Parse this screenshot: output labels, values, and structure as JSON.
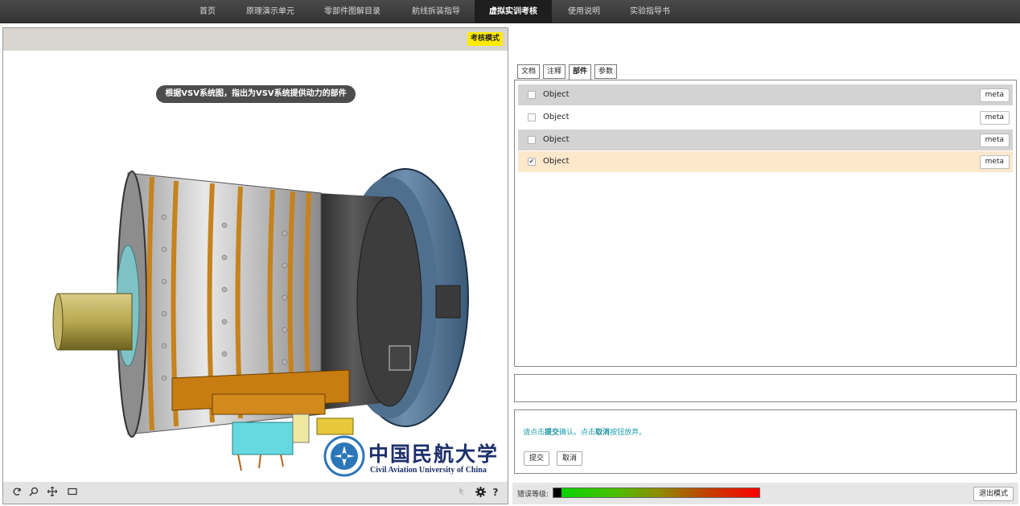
{
  "nav": {
    "items": [
      {
        "label": "首页"
      },
      {
        "label": "原理演示单元"
      },
      {
        "label": "零部件图解目录"
      },
      {
        "label": "航线拆装指导"
      },
      {
        "label": "虚拟实训考核"
      },
      {
        "label": "使用说明"
      },
      {
        "label": "实验指导书"
      }
    ],
    "active": "虚拟实训考核"
  },
  "viewer": {
    "mode_badge": "考核模式",
    "question": "根据VSV系统图，指出为VSV系统提供动力的部件",
    "logo": {
      "cn": "中国民航大学",
      "en": "Civil Aviation University of China"
    },
    "help_label": "?",
    "toolbar_icons": [
      "rotate-icon",
      "zoom-icon",
      "pan-icon",
      "fit-view-icon",
      "cursor-icon",
      "gear-icon",
      "help-icon"
    ]
  },
  "tabs": [
    {
      "label": "文档"
    },
    {
      "label": "注释"
    },
    {
      "label": "部件"
    },
    {
      "label": "参数"
    }
  ],
  "active_tab": "部件",
  "parts": [
    {
      "label": "Object",
      "checked": false,
      "meta": "meta"
    },
    {
      "label": "Object",
      "checked": false,
      "meta": "meta"
    },
    {
      "label": "Object",
      "checked": false,
      "meta": "meta"
    },
    {
      "label": "Object",
      "checked": true,
      "meta": "meta"
    }
  ],
  "confirm": {
    "msg_pre": "请点击",
    "msg_submit": "提交",
    "msg_mid": "确认。点击",
    "msg_cancel": "取消",
    "msg_post": "按钮放弃。",
    "submit_label": "提交",
    "cancel_label": "取消"
  },
  "status": {
    "error_label": "错误等级:",
    "error_level": 0.04,
    "exit_label": "退出模式"
  },
  "colors": {
    "row_gray": "#d3d3d3",
    "row_selected": "#fde8cc",
    "badge": "#ffeb00",
    "nav_bg": "#3c3c3c"
  }
}
